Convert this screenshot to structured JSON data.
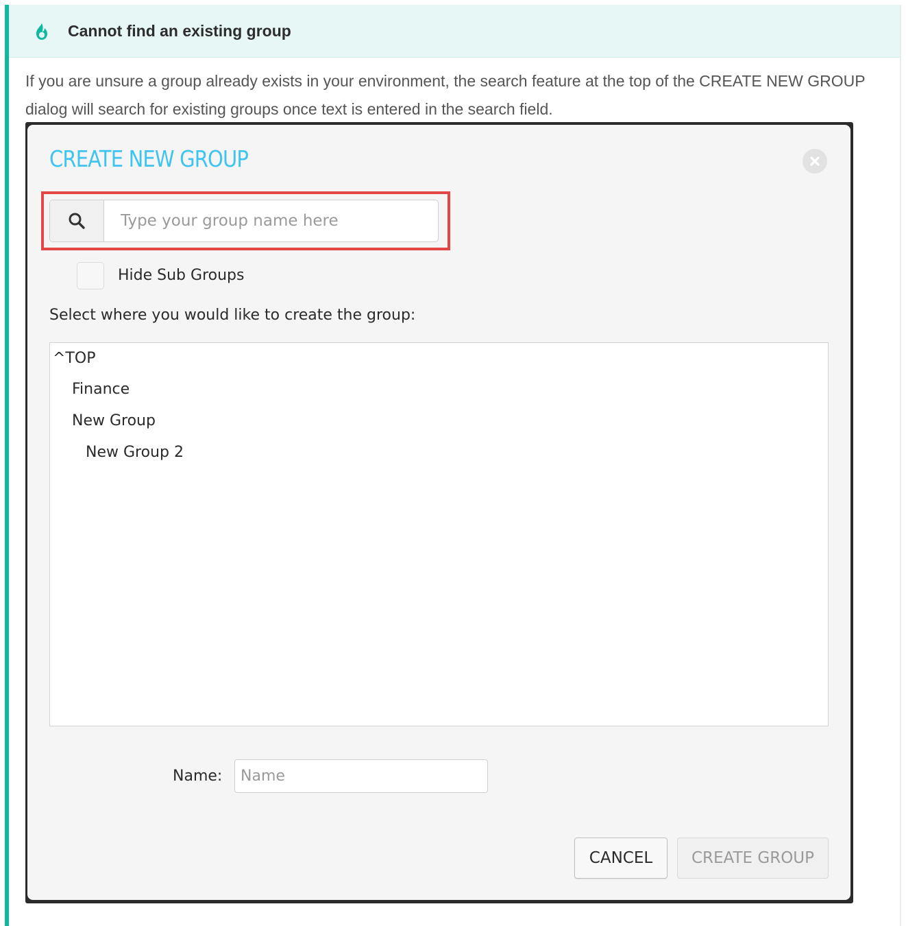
{
  "callout": {
    "title": "Cannot find an existing group",
    "body": "If you are unsure a group already exists in your environment, the search feature at the top of the CREATE NEW GROUP dialog will search for existing groups once text is entered in the search field.",
    "accent_color": "#0fb9a0",
    "icon": "flame-icon"
  },
  "dialog": {
    "title": "CREATE NEW GROUP",
    "title_color": "#3ec4ee",
    "search": {
      "placeholder": "Type your group name here",
      "value": "",
      "icon": "search-icon",
      "highlight_color": "#e24646"
    },
    "hide_sub_groups": {
      "label": "Hide Sub Groups",
      "checked": false
    },
    "select_prompt": "Select where you would like to create the group:",
    "tree": [
      {
        "label": "^TOP",
        "level": 0
      },
      {
        "label": "Finance",
        "level": 1
      },
      {
        "label": "New Group",
        "level": 1
      },
      {
        "label": "New Group 2",
        "level": 2
      }
    ],
    "name": {
      "label": "Name:",
      "placeholder": "Name",
      "value": ""
    },
    "buttons": {
      "cancel": "CANCEL",
      "create": "CREATE GROUP"
    }
  }
}
